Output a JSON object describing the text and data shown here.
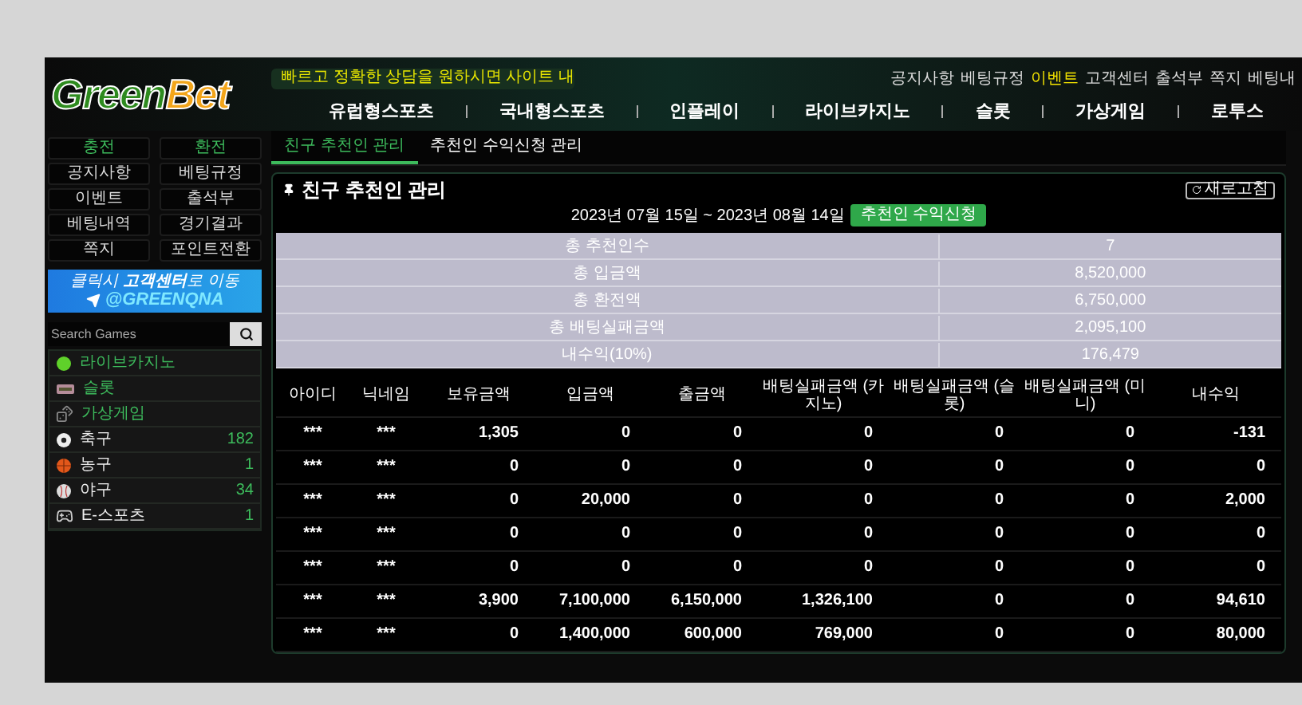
{
  "logo": {
    "parts": [
      "Green",
      "Bet"
    ]
  },
  "notice": {
    "text": "빠르고 정확한 상담을 원하시면 사이트 내"
  },
  "top_links": [
    {
      "label": "공지사항",
      "selected": false
    },
    {
      "label": "베팅규정",
      "selected": false
    },
    {
      "label": "이벤트",
      "selected": true
    },
    {
      "label": "고객센터",
      "selected": false
    },
    {
      "label": "출석부",
      "selected": false
    },
    {
      "label": "쪽지",
      "selected": false
    },
    {
      "label": "베팅내",
      "selected": false
    }
  ],
  "nav": [
    "유럽형스포츠",
    "국내형스포츠",
    "인플레이",
    "라이브카지노",
    "슬롯",
    "가상게임",
    "로투스"
  ],
  "sidebar": {
    "buttons": [
      {
        "label": "충전",
        "kind": "accent"
      },
      {
        "label": "환전",
        "kind": "accent"
      },
      {
        "label": "공지사항",
        "kind": "plain"
      },
      {
        "label": "베팅규정",
        "kind": "plain"
      },
      {
        "label": "이벤트",
        "kind": "plain"
      },
      {
        "label": "출석부",
        "kind": "plain"
      },
      {
        "label": "베팅내역",
        "kind": "plain"
      },
      {
        "label": "경기결과",
        "kind": "plain"
      },
      {
        "label": "쪽지",
        "kind": "plain"
      },
      {
        "label": "포인트전환",
        "kind": "plain"
      }
    ],
    "banner": {
      "line": "클릭시 **고객센터**로 이동",
      "handle": "@GREENQNA"
    },
    "search": {
      "placeholder": "Search Games"
    },
    "games": [
      {
        "label": "라이브카지노",
        "kind": "category"
      },
      {
        "label": "슬롯",
        "kind": "category"
      },
      {
        "label": "가상게임",
        "kind": "category"
      },
      {
        "label": "축구",
        "kind": "sport",
        "count": "182"
      },
      {
        "label": "농구",
        "kind": "sport",
        "count": "1"
      },
      {
        "label": "야구",
        "kind": "sport",
        "count": "34"
      },
      {
        "label": "E-스포츠",
        "kind": "sport",
        "count": "1"
      }
    ]
  },
  "tabs": [
    {
      "label": "친구 추천인 관리",
      "selected": true
    },
    {
      "label": "추천인 수익신청 관리",
      "selected": false
    }
  ],
  "panel": {
    "title": "친구 추천인 관리",
    "refresh": "새로고침",
    "period": "2023년 07월 15일 ~ 2023년 08월 14일",
    "apply_button": "추천인 수익신청",
    "summary": [
      {
        "label": "총 추천인수",
        "value": "7"
      },
      {
        "label": "총 입금액",
        "value": "8,520,000"
      },
      {
        "label": "총 환전액",
        "value": "6,750,000"
      },
      {
        "label": "총 배팅실패금액",
        "value": "2,095,100"
      },
      {
        "label": "내수익(10%)",
        "value": "176,479"
      }
    ],
    "table": {
      "columns": [
        "아이디",
        "닉네임",
        "보유금액",
        "입금액",
        "출금액",
        "배팅실패금액 (카지노)",
        "배팅실패금액 (슬롯)",
        "배팅실패금액 (미니)",
        "내수익"
      ],
      "rows": [
        [
          "***",
          "***",
          "1,305",
          "0",
          "0",
          "0",
          "0",
          "0",
          "-131"
        ],
        [
          "***",
          "***",
          "0",
          "0",
          "0",
          "0",
          "0",
          "0",
          "0"
        ],
        [
          "***",
          "***",
          "0",
          "20,000",
          "0",
          "0",
          "0",
          "0",
          "2,000"
        ],
        [
          "***",
          "***",
          "0",
          "0",
          "0",
          "0",
          "0",
          "0",
          "0"
        ],
        [
          "***",
          "***",
          "0",
          "0",
          "0",
          "0",
          "0",
          "0",
          "0"
        ],
        [
          "***",
          "***",
          "3,900",
          "7,100,000",
          "6,150,000",
          "1,326,100",
          "0",
          "0",
          "94,610"
        ],
        [
          "***",
          "***",
          "0",
          "1,400,000",
          "600,000",
          "769,000",
          "0",
          "0",
          "80,000"
        ]
      ]
    }
  }
}
